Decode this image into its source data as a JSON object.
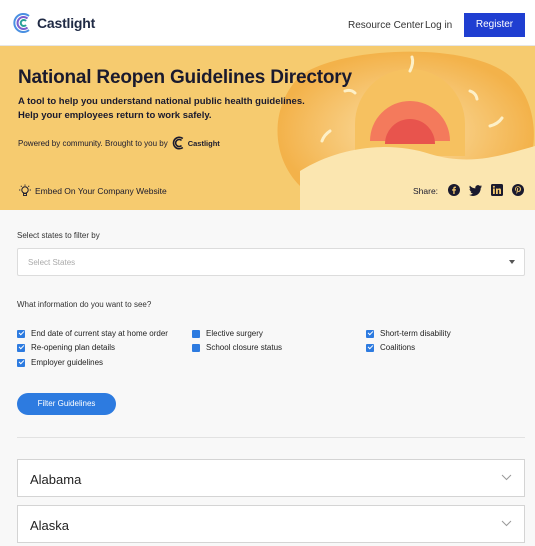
{
  "nav": {
    "logo_text": "Castlight",
    "resource_center": "Resource Center",
    "login": "Log in",
    "register": "Register"
  },
  "hero": {
    "title": "National Reopen Guidelines Directory",
    "subtitle_line1": "A tool to help you understand national public health guidelines.",
    "subtitle_line2": "Help your employees return to work safely.",
    "powered_by": "Powered by community. Brought to you by",
    "powered_logo_text": "Castlight",
    "embed": "Embed On Your Company Website",
    "share_label": "Share:",
    "social_icons": [
      "facebook-icon",
      "twitter-icon",
      "linkedin-icon",
      "pinterest-icon"
    ],
    "background_color": "#f6cb6f"
  },
  "filters": {
    "states_label": "Select states to filter by",
    "states_placeholder": "Select States",
    "info_label": "What information do you want to see?",
    "options": [
      {
        "label": "End date of current stay at home order",
        "checked": true
      },
      {
        "label": "Re-opening plan details",
        "checked": true
      },
      {
        "label": "Employer guidelines",
        "checked": true
      },
      {
        "label": "Elective surgery",
        "checked": false
      },
      {
        "label": "School closure status",
        "checked": false
      },
      {
        "label": "Short-term disability",
        "checked": true
      },
      {
        "label": "Coalitions",
        "checked": true
      }
    ],
    "button": "Filter Guidelines"
  },
  "states": [
    {
      "name": "Alabama"
    },
    {
      "name": "Alaska"
    }
  ],
  "colors": {
    "accent_blue": "#2d7be0",
    "register_blue": "#1f3ed1"
  }
}
